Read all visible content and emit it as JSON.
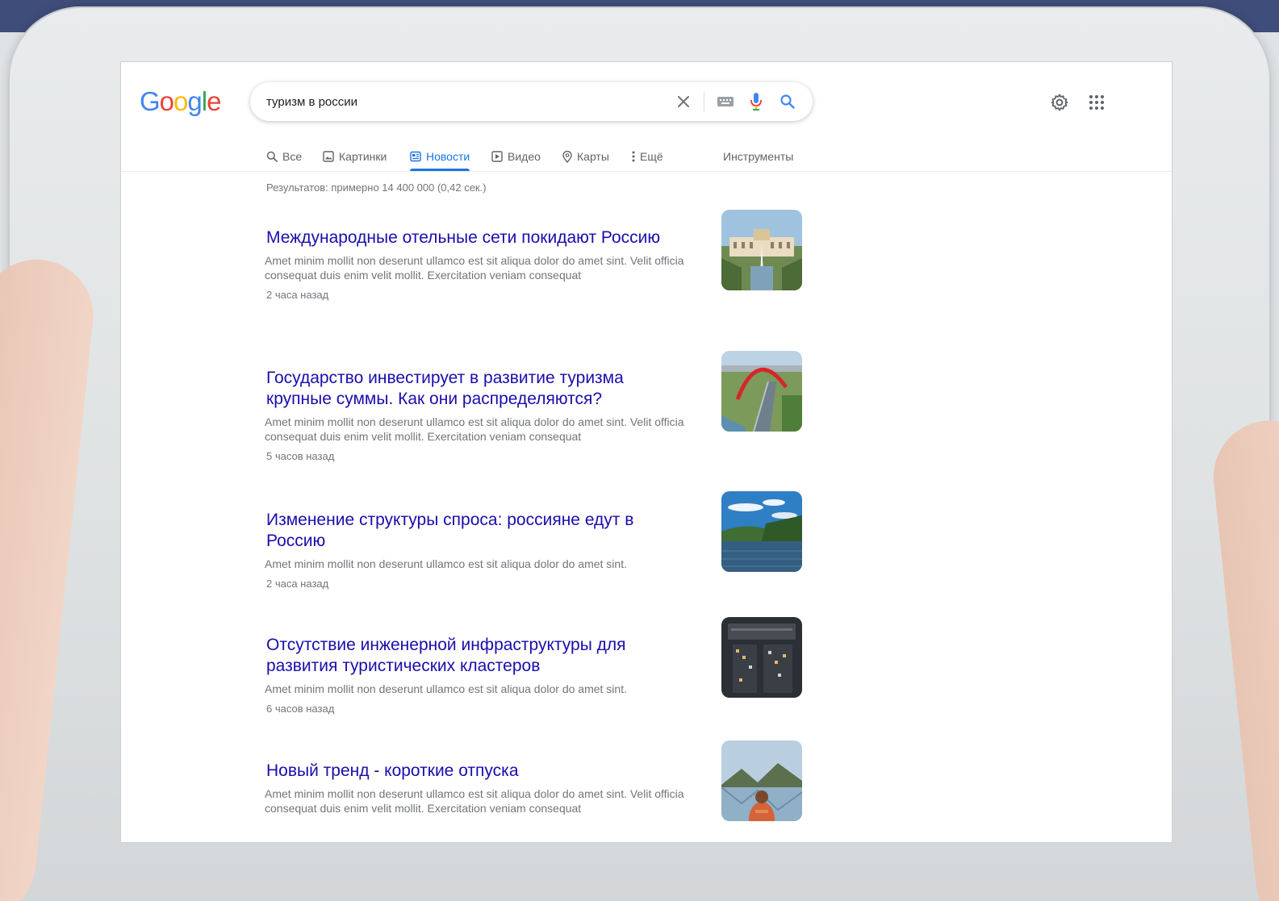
{
  "browser": {
    "logo": [
      "G",
      "o",
      "o",
      "g",
      "l",
      "e"
    ],
    "search": {
      "value": "туризм в россии"
    }
  },
  "tabs": [
    {
      "label": "Все",
      "icon": "search-icon"
    },
    {
      "label": "Картинки",
      "icon": "image-icon"
    },
    {
      "label": "Новости",
      "icon": "newspaper-icon",
      "active": true
    },
    {
      "label": "Видео",
      "icon": "play-icon"
    },
    {
      "label": "Карты",
      "icon": "map-pin-icon"
    },
    {
      "label": "Ещё",
      "icon": "more-vert-icon"
    },
    {
      "label": "Инструменты"
    }
  ],
  "stats": "Результатов: примерно 14 400 000 (0,42 сек.)",
  "results": [
    {
      "title": "Международные отельные сети покидают Россию",
      "snippet": "Amet minim mollit non deserunt ullamco est sit aliqua dolor do amet sint. Velit officia consequat duis enim velit mollit. Exercitation veniam consequat",
      "time": "2 часа назад"
    },
    {
      "title": "Государство инвестирует в развитие туризма крупные суммы. Как они распределяются?",
      "snippet": "Amet minim mollit non deserunt ullamco est sit aliqua dolor do amet sint. Velit officia consequat duis enim velit mollit. Exercitation veniam consequat",
      "time": "5 часов назад"
    },
    {
      "title": "Изменение структуры спроса: россияне едут в Россию",
      "snippet": "Amet minim mollit non deserunt ullamco est sit aliqua dolor do amet sint.",
      "time": "2 часа назад"
    },
    {
      "title": "Отсутствие инженерной инфраструктуры для развития туристических кластеров",
      "snippet": "Amet minim mollit non deserunt ullamco est sit aliqua dolor do amet sint.",
      "time": "6 часов назад"
    },
    {
      "title": "Новый тренд - короткие отпуска",
      "snippet": "Amet minim mollit non deserunt ullamco est sit aliqua dolor do amet sint. Velit officia consequat duis enim velit mollit. Exercitation veniam consequat",
      "time": ""
    }
  ],
  "colors": {
    "link": "#1a0dab",
    "accent": "#1a73e8",
    "muted": "#70757a"
  }
}
